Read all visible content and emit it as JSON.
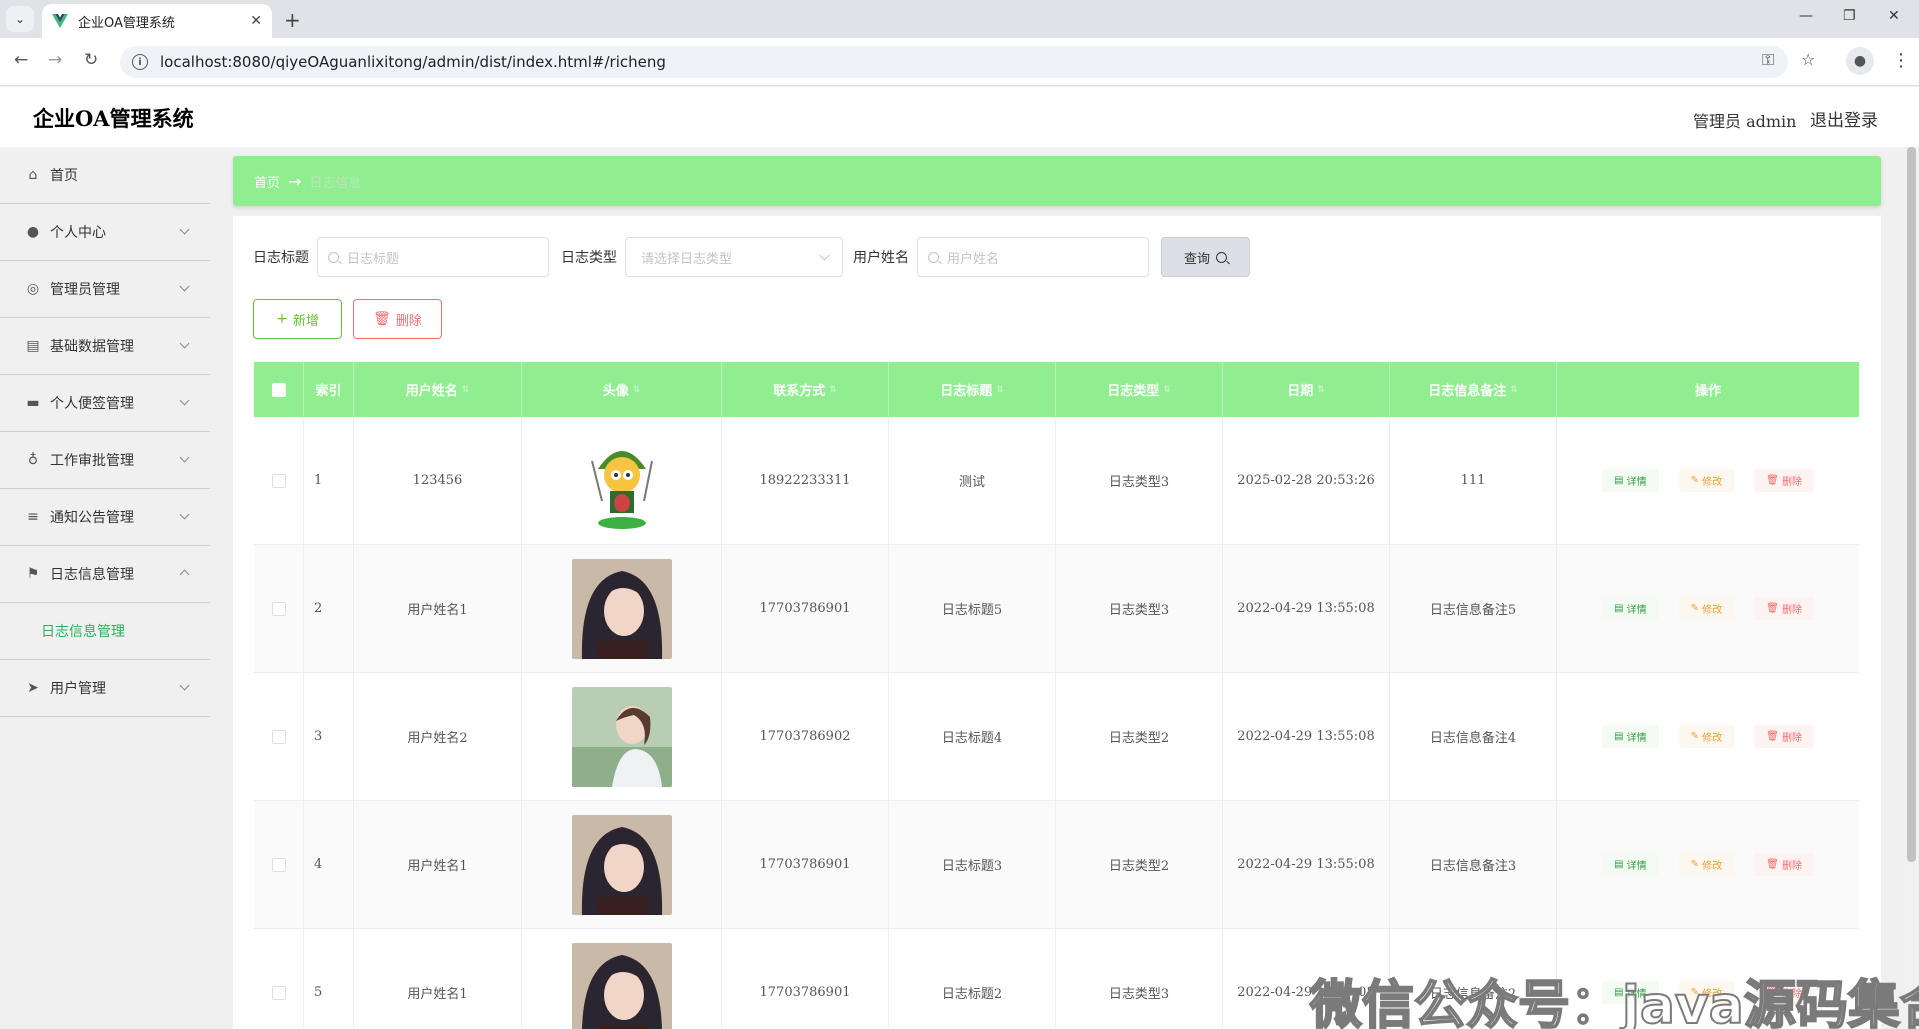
{
  "browser": {
    "tab_title": "企业OA管理系统",
    "url": "localhost:8080/qiyeOAguanlixitong/admin/dist/index.html#/richeng"
  },
  "header": {
    "title": "企业OA管理系统",
    "user": "管理员 admin",
    "logout": "退出登录"
  },
  "sidebar": {
    "items": [
      {
        "label": "首页",
        "icon": "home-icon"
      },
      {
        "label": "个人中心",
        "icon": "user-icon"
      },
      {
        "label": "管理员管理",
        "icon": "compass-icon"
      },
      {
        "label": "基础数据管理",
        "icon": "clipboard-icon"
      },
      {
        "label": "个人便签管理",
        "icon": "laptop-icon"
      },
      {
        "label": "工作审批管理",
        "icon": "microphone-icon"
      },
      {
        "label": "通知公告管理",
        "icon": "list-icon"
      },
      {
        "label": "日志信息管理",
        "icon": "flag-icon"
      },
      {
        "label": "用户管理",
        "icon": "send-icon"
      }
    ],
    "sub_item": "日志信息管理"
  },
  "breadcrumb": {
    "home": "首页",
    "current": "日志信息"
  },
  "search": {
    "title_label": "日志标题",
    "title_placeholder": "日志标题",
    "type_label": "日志类型",
    "type_placeholder": "请选择日志类型",
    "user_label": "用户姓名",
    "user_placeholder": "用户姓名",
    "query_button": "查询"
  },
  "actions": {
    "add": "新增",
    "delete": "删除"
  },
  "table": {
    "headers": [
      "索引",
      "用户姓名",
      "头像",
      "联系方式",
      "日志标题",
      "日志类型",
      "日期",
      "日志信息备注",
      "操作"
    ],
    "op_labels": {
      "detail": "详情",
      "edit": "修改",
      "remove": "删除"
    },
    "rows": [
      {
        "index": "1",
        "user": "123456",
        "phone": "18922233311",
        "title": "测试",
        "type": "日志类型3",
        "date": "2025-02-28 20:53:26",
        "note": "111",
        "avatar": "cartoon-avatar"
      },
      {
        "index": "2",
        "user": "用户姓名1",
        "phone": "17703786901",
        "title": "日志标题5",
        "type": "日志类型3",
        "date": "2022-04-29 13:55:08",
        "note": "日志信息备注5",
        "avatar": "photo-avatar-a"
      },
      {
        "index": "3",
        "user": "用户姓名2",
        "phone": "17703786902",
        "title": "日志标题4",
        "type": "日志类型2",
        "date": "2022-04-29 13:55:08",
        "note": "日志信息备注4",
        "avatar": "photo-avatar-b"
      },
      {
        "index": "4",
        "user": "用户姓名1",
        "phone": "17703786901",
        "title": "日志标题3",
        "type": "日志类型2",
        "date": "2022-04-29 13:55:08",
        "note": "日志信息备注3",
        "avatar": "photo-avatar-a"
      },
      {
        "index": "5",
        "user": "用户姓名1",
        "phone": "17703786901",
        "title": "日志标题2",
        "type": "日志类型3",
        "date": "2022-04-29 13:55:08",
        "note": "日志信息备注2",
        "avatar": "photo-avatar-a"
      }
    ]
  },
  "watermark": "微信公众号：java源码集合",
  "colors": {
    "accent_green": "#90ee90",
    "success": "#67c23a",
    "danger": "#f56c6c",
    "warning": "#e6a23c"
  }
}
